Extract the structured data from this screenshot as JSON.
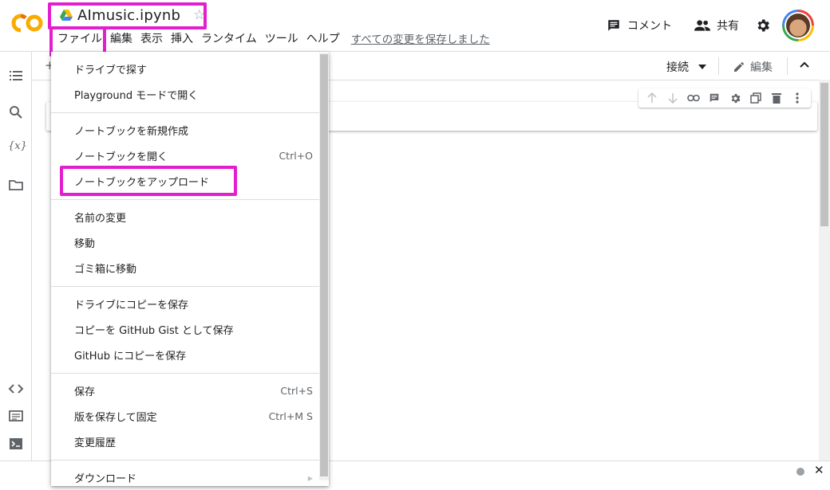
{
  "app": {
    "logo": "CO",
    "notebook_title": "AImusic.ipynb",
    "drive_icon": "google-drive-icon",
    "star_icon": "star-outline-icon"
  },
  "menubar": {
    "items": [
      "ファイル",
      "編集",
      "表示",
      "挿入",
      "ランタイム",
      "ツール",
      "ヘルプ"
    ],
    "saved_status": "すべての変更を保存しました"
  },
  "header_actions": {
    "comment_label": "コメント",
    "share_label": "共有"
  },
  "toolbar": {
    "add_label": "+",
    "connect_label": "接続",
    "edit_label": "編集"
  },
  "file_menu": {
    "items": [
      {
        "label": "ドライブで探す",
        "shortcut": ""
      },
      {
        "label": "Playground モードで開く",
        "shortcut": ""
      },
      {
        "label": "ノートブックを新規作成",
        "shortcut": ""
      },
      {
        "label": "ノートブックを開く",
        "shortcut": "Ctrl+O"
      },
      {
        "label": "ノートブックをアップロード",
        "shortcut": ""
      },
      {
        "label": "名前の変更",
        "shortcut": ""
      },
      {
        "label": "移動",
        "shortcut": ""
      },
      {
        "label": "ゴミ箱に移動",
        "shortcut": ""
      },
      {
        "label": "ドライブにコピーを保存",
        "shortcut": ""
      },
      {
        "label": "コピーを GitHub Gist として保存",
        "shortcut": ""
      },
      {
        "label": "GitHub にコピーを保存",
        "shortcut": ""
      },
      {
        "label": "保存",
        "shortcut": "Ctrl+S"
      },
      {
        "label": "版を保存して固定",
        "shortcut": "Ctrl+M S"
      },
      {
        "label": "変更履歴",
        "shortcut": ""
      },
      {
        "label": "ダウンロード",
        "shortcut": ""
      }
    ]
  },
  "colors": {
    "highlight": "#e21fcf",
    "logo_orange": "#f9ab00",
    "drive_blue": "#4285f4"
  }
}
